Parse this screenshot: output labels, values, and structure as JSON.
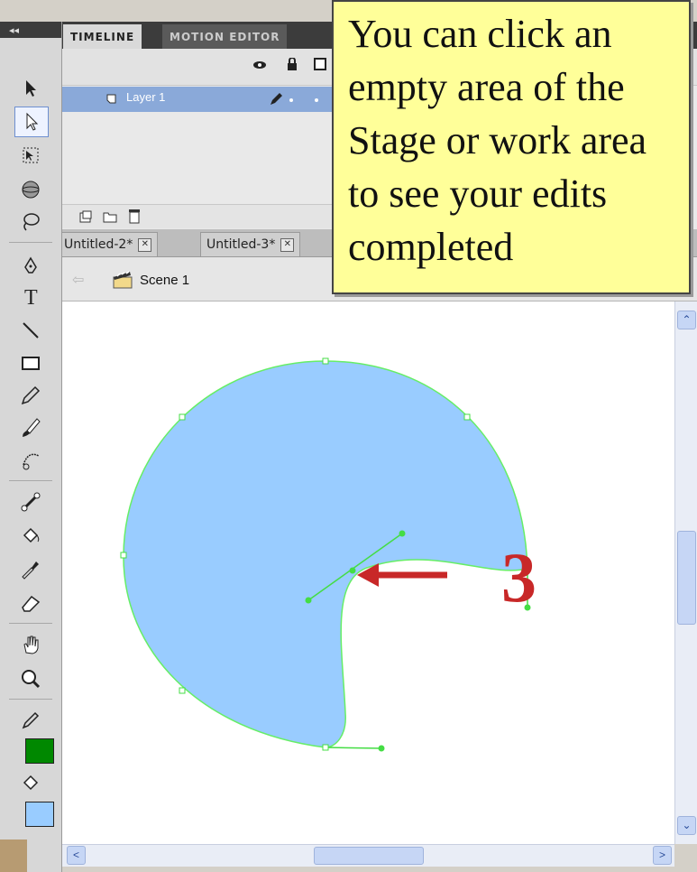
{
  "timeline": {
    "tabs": [
      "TIMELINE",
      "MOTION EDITOR"
    ],
    "layer_name": "Layer 1"
  },
  "documents": {
    "tabs": [
      "Untitled-2*",
      "Untitled-3*"
    ],
    "close_glyph": "✕"
  },
  "scene": {
    "label": "Scene 1",
    "back_icon": "arrow-left-icon",
    "scene_icon": "clapperboard-icon"
  },
  "toolbar": {
    "collapse_glyph": "◂◂",
    "tools": [
      "selection-tool-icon",
      "subselection-tool-icon",
      "free-transform-tool-icon",
      "3d-rotation-tool-icon",
      "lasso-tool-icon",
      "pen-tool-icon",
      "text-tool-icon",
      "line-tool-icon",
      "rectangle-tool-icon",
      "pencil-tool-icon",
      "brush-tool-icon",
      "deco-tool-icon",
      "bone-tool-icon",
      "paint-bucket-tool-icon",
      "eyedropper-tool-icon",
      "eraser-tool-icon",
      "hand-tool-icon",
      "zoom-tool-icon"
    ],
    "stroke_color": "#008800",
    "fill_color": "#99ccff"
  },
  "callout": {
    "text": "You can click an empty area of the Stage or work area to see your edits completed"
  },
  "annotation": {
    "step_number": "3",
    "color": "#c82828"
  },
  "stage": {
    "shape_fill": "#99ccff",
    "path_color": "#66ee66"
  },
  "scrollbars": {
    "up": "⌃",
    "down": "⌄",
    "left": "<",
    "right": ">"
  }
}
